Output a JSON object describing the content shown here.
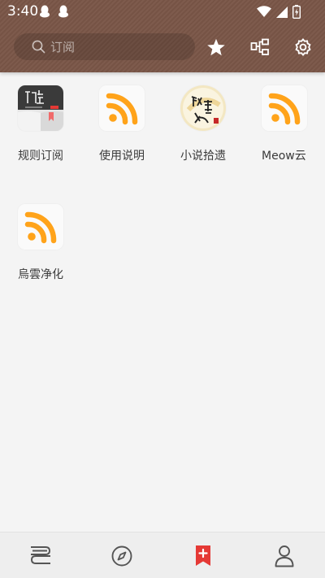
{
  "status_bar": {
    "time": "3:40",
    "left_icons": [
      "qq-icon",
      "qq-icon"
    ],
    "right_icons": [
      "wifi-icon",
      "signal-icon",
      "battery-charging-icon"
    ]
  },
  "app_bar": {
    "search_placeholder": "订阅",
    "actions": [
      "star-icon",
      "group-icon",
      "settings-icon"
    ]
  },
  "subscriptions": [
    {
      "label": "规则订阅",
      "icon": "book-reader-icon"
    },
    {
      "label": "使用说明",
      "icon": "rss-icon"
    },
    {
      "label": "小说拾遗",
      "icon": "calligraphy-logo-icon"
    },
    {
      "label": "Meow云",
      "icon": "rss-icon"
    },
    {
      "label": "烏雲净化",
      "icon": "rss-icon"
    }
  ],
  "bottom_nav": {
    "items": [
      "bookshelf-icon",
      "explore-compass-icon",
      "rss-bookmark-icon",
      "profile-icon"
    ],
    "active": "rss-bookmark-icon"
  },
  "colors": {
    "app_bar": "#7a5647",
    "accent": "#e53935",
    "rss_orange": "#ffa31a"
  }
}
